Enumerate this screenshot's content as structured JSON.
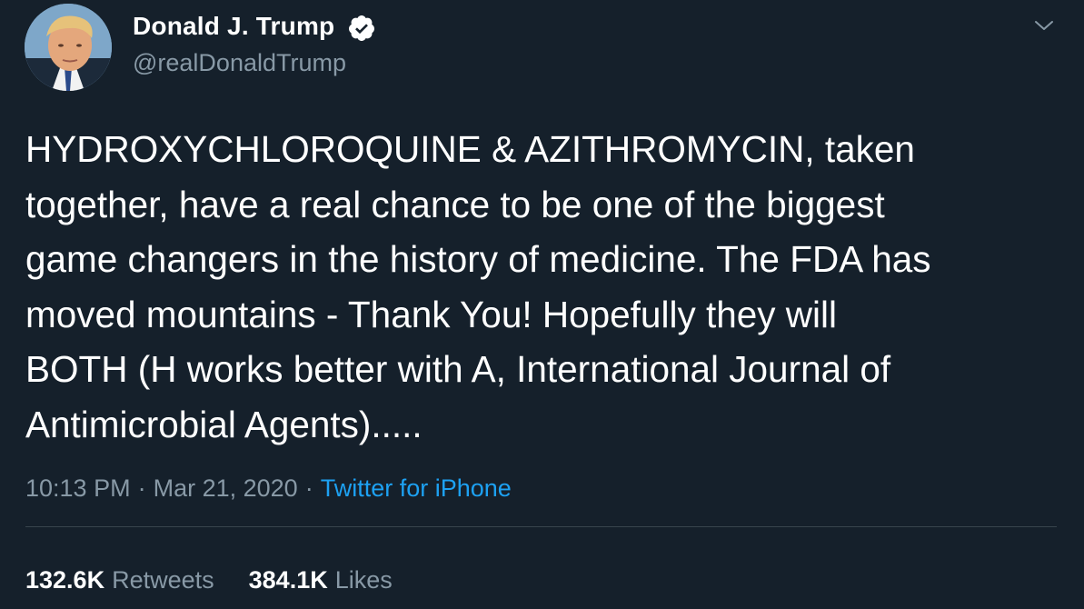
{
  "tweet": {
    "author": {
      "display_name": "Donald J. Trump",
      "handle": "@realDonaldTrump",
      "verified": true,
      "avatar_icon": "profile-photo"
    },
    "menu_icon": "chevron-down-icon",
    "text_lines": [
      "HYDROXYCHLOROQUINE & AZITHROMYCIN, taken",
      "together, have a real chance to be one of the biggest",
      "game changers in the history of medicine. The FDA has",
      "moved mountains - Thank You! Hopefully they will",
      "BOTH (H works better with A, International Journal of",
      "Antimicrobial Agents)....."
    ],
    "time": "10:13 PM",
    "date": "Mar 21, 2020",
    "separator": "·",
    "source": "Twitter for iPhone",
    "stats": {
      "retweets_count": "132.6K",
      "retweets_label": "Retweets",
      "likes_count": "384.1K",
      "likes_label": "Likes"
    }
  },
  "colors": {
    "background": "#15202b",
    "text": "#ffffff",
    "secondary_text": "#8899a6",
    "link": "#1da1f2",
    "divider": "#38444d"
  }
}
